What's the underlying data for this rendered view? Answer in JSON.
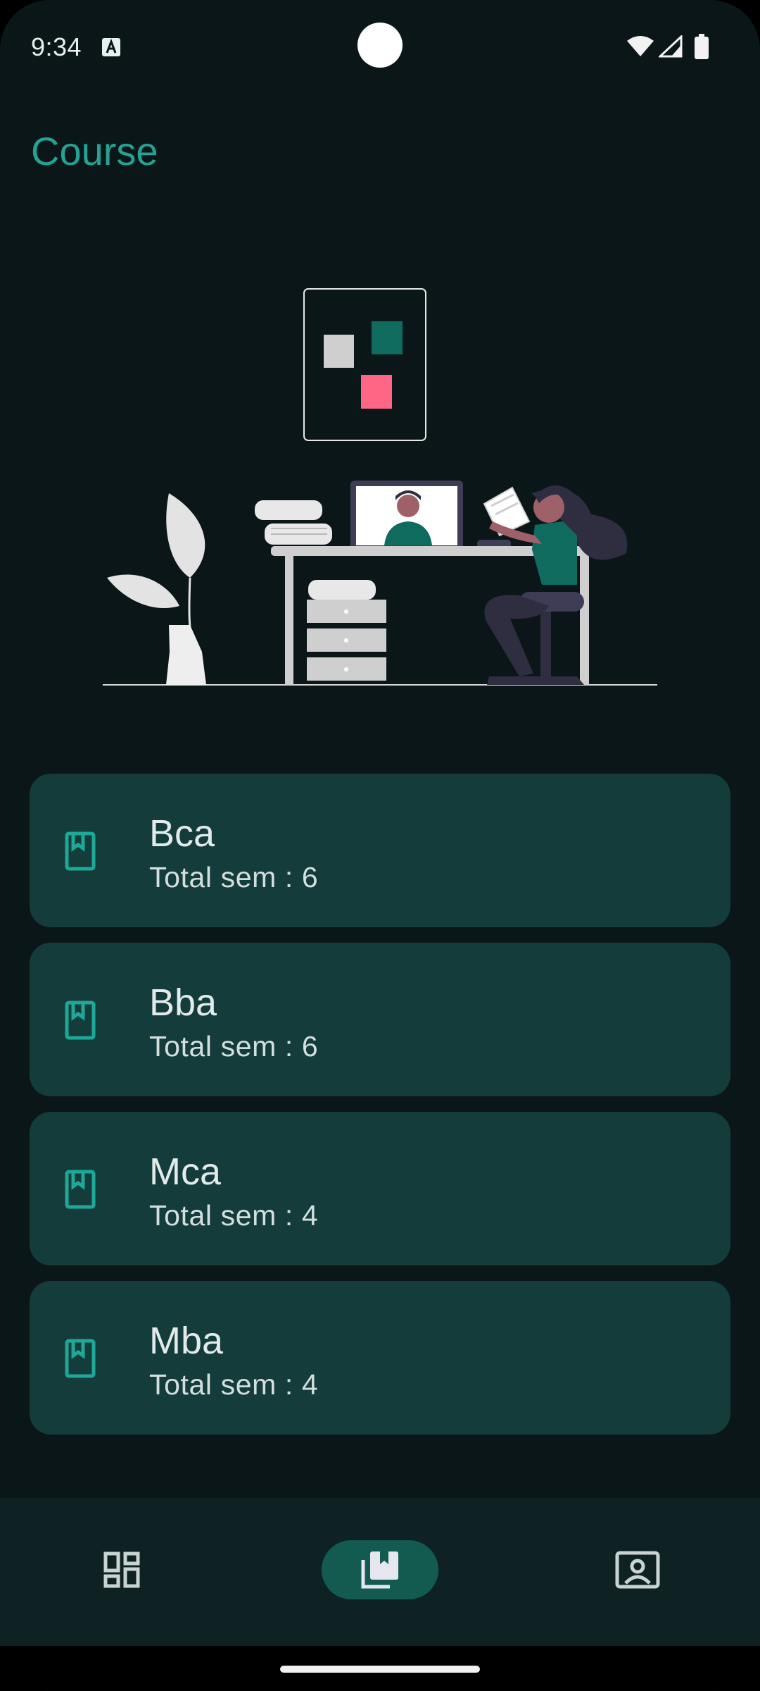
{
  "status_bar": {
    "time": "9:34",
    "icons": [
      "text-a-icon",
      "wifi-icon",
      "signal-icon",
      "battery-icon"
    ]
  },
  "page": {
    "title": "Course"
  },
  "colors": {
    "background": "#0b1619",
    "accent": "#25a294",
    "card": "#133c3b",
    "nav_bar": "#0e2224",
    "nav_active": "#135a50"
  },
  "courses": [
    {
      "name": "Bca",
      "sem": "Total sem : 6"
    },
    {
      "name": "Bba",
      "sem": "Total sem : 6"
    },
    {
      "name": "Mca",
      "sem": "Total sem : 4"
    },
    {
      "name": "Mba",
      "sem": "Total sem : 4"
    }
  ],
  "bottom_nav": {
    "active": "course",
    "items": [
      {
        "id": "dashboard",
        "icon": "dashboard-icon"
      },
      {
        "id": "course",
        "icon": "library-books-icon"
      },
      {
        "id": "profile",
        "icon": "contact-profile-icon"
      }
    ]
  }
}
